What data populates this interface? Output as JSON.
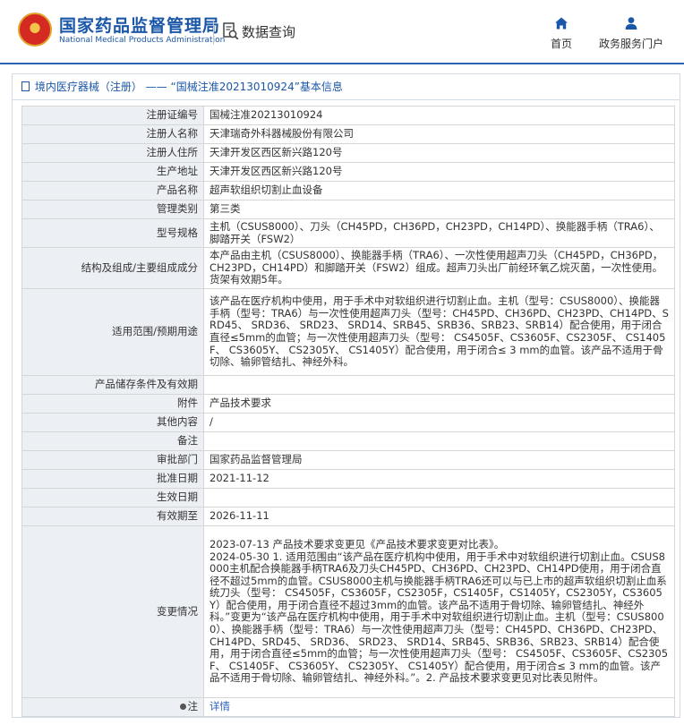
{
  "header": {
    "org_name_cn": "国家药品监督管理局",
    "org_name_en": "National Medical Products Administration",
    "query_label": "数据查询",
    "nav": [
      {
        "label": "首页",
        "icon": "home-icon"
      },
      {
        "label": "政务服务门户",
        "icon": "user-icon"
      }
    ]
  },
  "breadcrumb": {
    "category": "境内医疗器械（注册）",
    "separator": "——",
    "title": "“国械注准20213010924”基本信息"
  },
  "rows": [
    {
      "label": "注册证编号",
      "value": "国械注准20213010924"
    },
    {
      "label": "注册人名称",
      "value": "天津瑞奇外科器械股份有限公司"
    },
    {
      "label": "注册人住所",
      "value": "天津开发区西区新兴路120号"
    },
    {
      "label": "生产地址",
      "value": "天津开发区西区新兴路120号"
    },
    {
      "label": "产品名称",
      "value": "超声软组织切割止血设备"
    },
    {
      "label": "管理类别",
      "value": "第三类"
    },
    {
      "label": "型号规格",
      "value": "主机（CSUS8000）、刀头（CH45PD，CH36PD，CH23PD，CH14PD）、换能器手柄（TRA6）、脚踏开关（FSW2）"
    },
    {
      "label": "结构及组成/主要组成成分",
      "value": "本产品由主机（CSUS8000）、换能器手柄（TRA6）、一次性使用超声刀头（CH45PD，CH36PD，CH23PD，CH14PD）和脚踏开关（FSW2）组成。超声刀头出厂前经环氧乙烷灭菌，一次性使用。货架有效期5年。"
    },
    {
      "label": "适用范围/预期用途",
      "value": "该产品在医疗机构中使用，用于手术中对软组织进行切割止血。主机（型号：CSUS8000）、换能器手柄（型号：TRA6）与一次性使用超声刀头（型号：CH45PD、CH36PD、CH23PD、CH14PD、SRD45、 SRD36、 SRD23、 SRD14、SRB45、SRB36、SRB23、SRB14）配合使用，用于闭合直径≤5mm的血管；与一次性使用超声刀头（型号： CS4505F、CS3605F、CS2305F、 CS1405F、 CS3605Y、 CS2305Y、 CS1405Y）配合使用，用于闭合≤ 3 mm的血管。该产品不适用于骨切除、输卵管结扎、神经外科。"
    },
    {
      "label": "产品储存条件及有效期",
      "value": ""
    },
    {
      "label": "附件",
      "value": "产品技术要求"
    },
    {
      "label": "其他内容",
      "value": "/"
    },
    {
      "label": "备注",
      "value": ""
    },
    {
      "label": "审批部门",
      "value": "国家药品监督管理局"
    },
    {
      "label": "批准日期",
      "value": "2021-11-12"
    },
    {
      "label": "生效日期",
      "value": ""
    },
    {
      "label": "有效期至",
      "value": "2026-11-11"
    }
  ],
  "change_info": {
    "label": "变更情况",
    "entries": [
      "2023-07-13 产品技术要求变更见《产品技术要求变更对比表》。",
      "2024-05-30 1. 适用范围由“该产品在医疗机构中使用，用于手术中对软组织进行切割止血。CSUS8000主机配合换能器手柄TRA6及刀头CH45PD、CH36PD、CH23PD、CH14PD使用，用于闭合直径不超过5mm的血管。CSUS8000主机与换能器手柄TRA6还可以与已上市的超声软组织切割止血系统刀头（型号： CS4505F，CS3605F，CS2305F，CS1405F，CS1405Y，CS2305Y，CS3605Y）配合使用，用于闭合直径不超过3mm的血管。该产品不适用于骨切除、输卵管结扎、神经外科。”变更为“该产品在医疗机构中使用，用于手术中对软组织进行切割止血。主机（型号：CSUS8000）、换能器手柄（型号：TRA6）与一次性使用超声刀头（型号：CH45PD、CH36PD、CH23PD、CH14PD、SRD45、 SRD36、 SRD23、 SRD14、SRB45、SRB36、SRB23、SRB14）配合使用，用于闭合直径≤5mm的血管；与一次性使用超声刀头（型号： CS4505F、CS3605F、CS2305F、 CS1405F、 CS3605Y、 CS2305Y、 CS1405Y）配合使用，用于闭合≤ 3 mm的血管。该产品不适用于骨切除、输卵管结扎、神经外科。”。2. 产品技术要求变更见对比表见附件。"
    ]
  },
  "note_row": {
    "label": "注",
    "link": "详情"
  }
}
